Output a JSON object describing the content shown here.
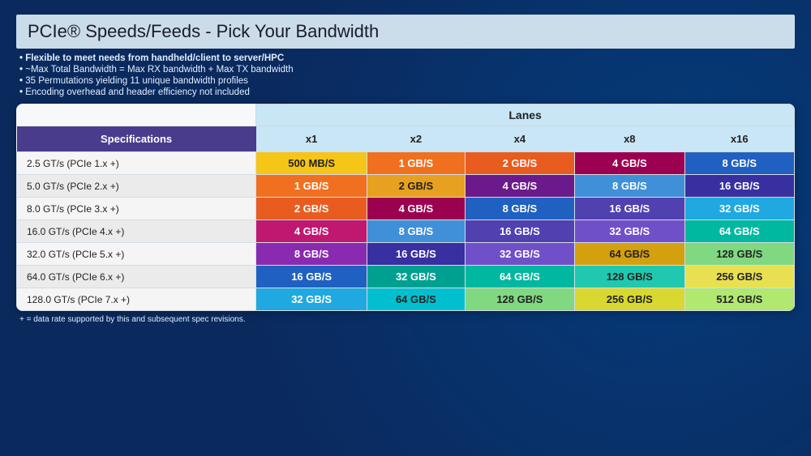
{
  "page": {
    "title": "PCIe® Speeds/Feeds - Pick Your Bandwidth",
    "bullets": [
      "Flexible to meet needs from handheld/client to server/HPC",
      "~Max Total Bandwidth = Max RX bandwidth + Max TX bandwidth",
      "35 Permutations yielding 11 unique bandwidth profiles",
      "Encoding overhead and header efficiency not included"
    ],
    "footer_note": "+ = data rate supported by this and subsequent spec revisions."
  },
  "table": {
    "lanes_header": "Lanes",
    "col_specs": "Specifications",
    "col_lanes": [
      "x1",
      "x2",
      "x4",
      "x8",
      "x16"
    ],
    "rows": [
      {
        "spec": "2.5 GT/s (PCIe 1.x +)",
        "values": [
          "500 MB/S",
          "1 GB/S",
          "2 GB/S",
          "4 GB/S",
          "8 GB/S"
        ],
        "colors": [
          "c-yellow",
          "c-orange",
          "c-orange2",
          "c-crimson",
          "c-blue-med"
        ]
      },
      {
        "spec": "5.0 GT/s (PCIe 2.x +)",
        "values": [
          "1 GB/S",
          "2 GB/S",
          "4 GB/S",
          "8 GB/S",
          "16 GB/S"
        ],
        "colors": [
          "c-orange",
          "c-amber",
          "c-purple",
          "c-blue-lt",
          "c-navy-pur"
        ]
      },
      {
        "spec": "8.0 GT/s (PCIe 3.x +)",
        "values": [
          "2 GB/S",
          "4 GB/S",
          "8 GB/S",
          "16 GB/S",
          "32 GB/S"
        ],
        "colors": [
          "c-orange2",
          "c-crimson",
          "c-blue-med",
          "c-indigo",
          "c-sky"
        ]
      },
      {
        "spec": "16.0 GT/s (PCIe 4.x +)",
        "values": [
          "4 GB/S",
          "8 GB/S",
          "16 GB/S",
          "32 GB/S",
          "64 GB/S"
        ],
        "colors": [
          "c-magenta",
          "c-blue-lt",
          "c-indigo",
          "c-violet",
          "c-teal2"
        ]
      },
      {
        "spec": "32.0 GT/s (PCIe 5.x +)",
        "values": [
          "8 GB/S",
          "16 GB/S",
          "32 GB/S",
          "64 GB/S",
          "128 GB/S"
        ],
        "colors": [
          "c-purple2",
          "c-navy-pur",
          "c-violet",
          "c-gold",
          "c-green-lt"
        ]
      },
      {
        "spec": "64.0 GT/s (PCIe 6.x +)",
        "values": [
          "16 GB/S",
          "32 GB/S",
          "64 GB/S",
          "128 GB/S",
          "256 GB/S"
        ],
        "colors": [
          "c-blue-med",
          "c-teal",
          "c-teal2",
          "c-teal3",
          "c-lt-yellow"
        ]
      },
      {
        "spec": "128.0 GT/s (PCIe 7.x +)",
        "values": [
          "32 GB/S",
          "64 GB/S",
          "128 GB/S",
          "256 GB/S",
          "512 GB/S"
        ],
        "colors": [
          "c-sky",
          "c-cyan",
          "c-green-lt",
          "c-lt-yellow2",
          "c-lt-green"
        ]
      }
    ]
  }
}
